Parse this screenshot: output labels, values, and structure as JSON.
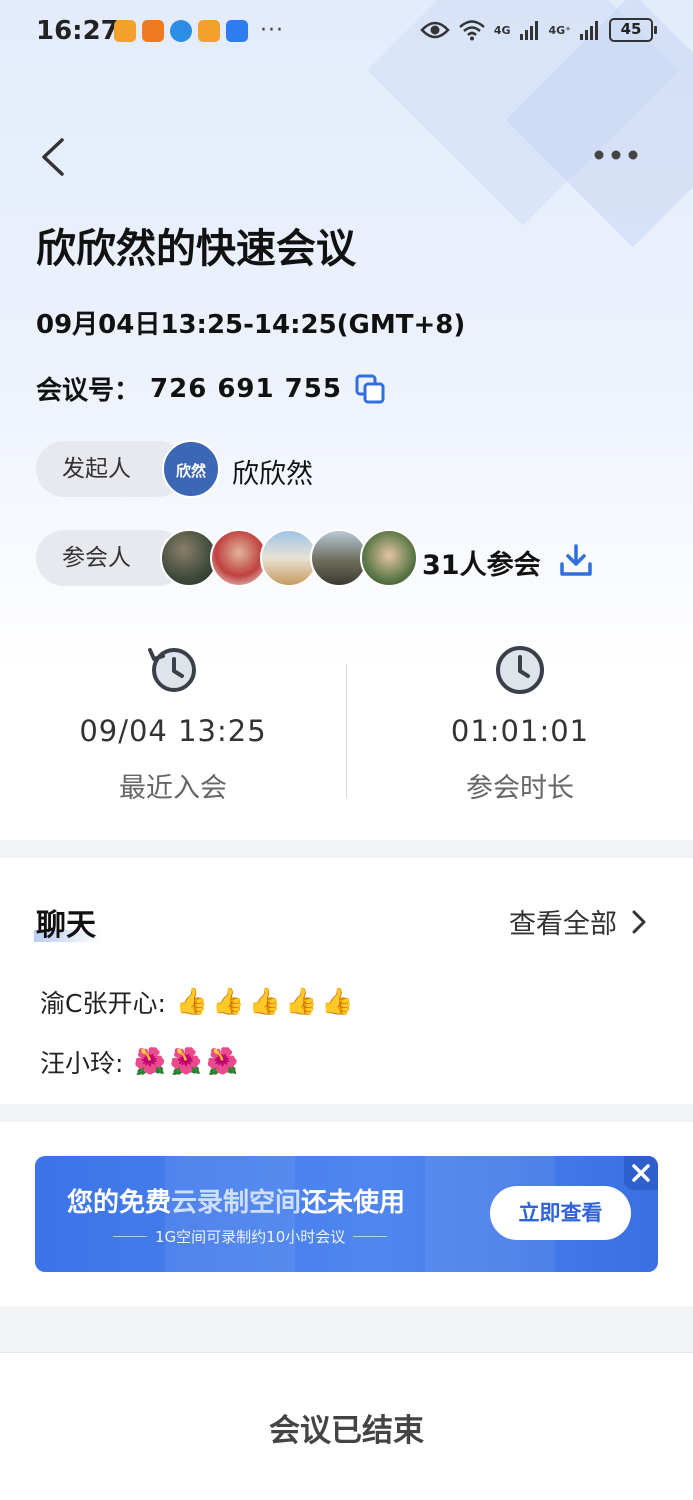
{
  "status_bar": {
    "time": "16:27",
    "more": "···",
    "network_1": "4G",
    "network_2": "4G⁺",
    "battery": "45"
  },
  "meeting": {
    "title": "欣欣然的快速会议",
    "time_range": "09月04日13:25-14:25(GMT+8)",
    "id_label": "会议号：",
    "id": "726 691 755"
  },
  "initiator": {
    "label": "发起人",
    "avatar_text": "欣然",
    "name": "欣欣然"
  },
  "participants": {
    "label": "参会人",
    "count_text": "31人参会"
  },
  "stats": {
    "last_join_value": "09/04 13:25",
    "last_join_label": "最近入会",
    "duration_value": "01:01:01",
    "duration_label": "参会时长"
  },
  "chat": {
    "title": "聊天",
    "view_all": "查看全部",
    "messages": [
      {
        "sender": "渝C张开心:",
        "emojis": [
          "👍",
          "👍",
          "👍",
          "👍",
          "👍"
        ]
      },
      {
        "sender": "汪小玲:",
        "emojis": [
          "🌺",
          "🌺",
          "🌺"
        ]
      }
    ]
  },
  "banner": {
    "title_pre": "您的免费",
    "title_highlight": "云录制空间",
    "title_post": "还未使用",
    "subtitle": "1G空间可录制约10小时会议",
    "cta": "立即查看"
  },
  "footer": {
    "status": "会议已结束"
  },
  "colors": {
    "accent": "#2f6fe0",
    "banner_blue": "#4a80ee",
    "host_avatar": "#3b67b5"
  }
}
